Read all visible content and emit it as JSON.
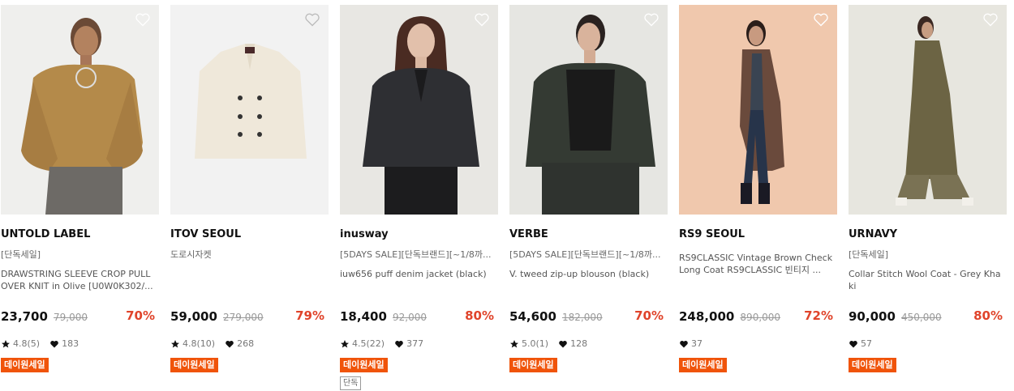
{
  "colors": {
    "discount": "#e0442b",
    "badge": "#f0540a"
  },
  "products": [
    {
      "brand": "UNTOLD LABEL",
      "sub": "[단독세일]",
      "desc": "DRAWSTRING SLEEVE CROP PULLOVER KNIT in Olive [U0W0K302/...",
      "price": "23,700",
      "orig": "79,000",
      "disc": "70%",
      "rating": "4.8(5)",
      "likes": "183",
      "badge": "데이원세일",
      "badge2": "",
      "icons": {
        "heart": "heart-outline-icon",
        "star": "star-icon",
        "like": "heart-filled-icon"
      }
    },
    {
      "brand": "ITOV SEOUL",
      "sub": "도로시자켓",
      "desc": "",
      "price": "59,000",
      "orig": "279,000",
      "disc": "79%",
      "rating": "4.8(10)",
      "likes": "268",
      "badge": "데이원세일",
      "badge2": ""
    },
    {
      "brand": "inusway",
      "sub": "[5DAYS SALE][단독브랜드][~1/8까...",
      "desc": "iuw656 puff denim jacket (black)",
      "price": "18,400",
      "orig": "92,000",
      "disc": "80%",
      "rating": "4.5(22)",
      "likes": "377",
      "badge": "데이원세일",
      "badge2": "단독"
    },
    {
      "brand": "VERBE",
      "sub": "[5DAYS SALE][단독브랜드][~1/8까...",
      "desc": "V. tweed zip-up blouson (black)",
      "price": "54,600",
      "orig": "182,000",
      "disc": "70%",
      "rating": "5.0(1)",
      "likes": "128",
      "badge": "데이원세일",
      "badge2": ""
    },
    {
      "brand": "RS9 SEOUL",
      "sub": "",
      "desc": "RS9CLASSIC Vintage Brown Check Long Coat RS9CLASSIC 빈티지 ...",
      "price": "248,000",
      "orig": "890,000",
      "disc": "72%",
      "rating": "",
      "likes": "37",
      "badge": "데이원세일",
      "badge2": ""
    },
    {
      "brand": "URNAVY",
      "sub": "[단독세일]",
      "desc": "Collar Stitch Wool Coat - Grey Khaki",
      "price": "90,000",
      "orig": "450,000",
      "disc": "80%",
      "rating": "",
      "likes": "57",
      "badge": "데이원세일",
      "badge2": ""
    }
  ]
}
